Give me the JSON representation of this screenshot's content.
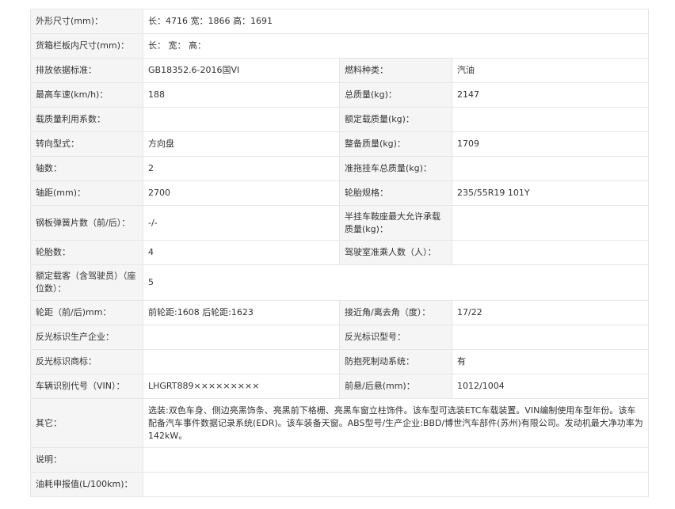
{
  "rows": [
    {
      "cells": [
        {
          "label": "外形尺寸(mm)："
        },
        {
          "value": "长：4716 宽：1866 高：1691",
          "span": 3
        }
      ]
    },
    {
      "cells": [
        {
          "label": "货箱栏板内尺寸(mm)："
        },
        {
          "value": "长： 宽： 高：",
          "span": 3
        }
      ]
    },
    {
      "cells": [
        {
          "label": "排放依据标准："
        },
        {
          "value": "GB18352.6-2016国VI"
        },
        {
          "label": "燃料种类："
        },
        {
          "value": "汽油"
        }
      ]
    },
    {
      "cells": [
        {
          "label": "最高车速(km/h)："
        },
        {
          "value": "188"
        },
        {
          "label": "总质量(kg)："
        },
        {
          "value": "2147"
        }
      ]
    },
    {
      "cells": [
        {
          "label": "载质量利用系数："
        },
        {
          "value": ""
        },
        {
          "label": "额定载质量(kg)："
        },
        {
          "value": ""
        }
      ]
    },
    {
      "cells": [
        {
          "label": "转向型式："
        },
        {
          "value": "方向盘"
        },
        {
          "label": "整备质量(kg)："
        },
        {
          "value": "1709"
        }
      ]
    },
    {
      "cells": [
        {
          "label": "轴数："
        },
        {
          "value": "2"
        },
        {
          "label": "准拖挂车总质量(kg)："
        },
        {
          "value": ""
        }
      ]
    },
    {
      "cells": [
        {
          "label": "轴距(mm)："
        },
        {
          "value": "2700"
        },
        {
          "label": "轮胎规格："
        },
        {
          "value": "235/55R19 101Y"
        }
      ]
    },
    {
      "cells": [
        {
          "label": "钢板弹簧片数（前/后）："
        },
        {
          "value": "-/-"
        },
        {
          "label": "半挂车鞍座最大允许承载质量(kg)："
        },
        {
          "value": ""
        }
      ]
    },
    {
      "cells": [
        {
          "label": "轮胎数："
        },
        {
          "value": "4"
        },
        {
          "label": "驾驶室准乘人数（人）："
        },
        {
          "value": ""
        }
      ]
    },
    {
      "cells": [
        {
          "label": "额定载客（含驾驶员）（座位数）："
        },
        {
          "value": "5",
          "span": 3
        }
      ]
    },
    {
      "cells": [
        {
          "label": "轮距（前/后)mm："
        },
        {
          "value": "前轮距:1608 后轮距:1623"
        },
        {
          "label": "接近角/离去角（度）："
        },
        {
          "value": "17/22"
        }
      ]
    },
    {
      "cells": [
        {
          "label": "反光标识生产企业："
        },
        {
          "value": ""
        },
        {
          "label": "反光标识型号："
        },
        {
          "value": ""
        }
      ]
    },
    {
      "cells": [
        {
          "label": "反光标识商标："
        },
        {
          "value": ""
        },
        {
          "label": "防抱死制动系统："
        },
        {
          "value": "有"
        }
      ]
    },
    {
      "cells": [
        {
          "label": "车辆识别代号（VIN）："
        },
        {
          "value": "LHGRT889×××××××××"
        },
        {
          "label": "前悬/后悬(mm)："
        },
        {
          "value": "1012/1004"
        }
      ]
    },
    {
      "cells": [
        {
          "label": "其它："
        },
        {
          "value": "选装:双色车身、侧边亮黑饰条、亮黑前下格栅、亮黑车窗立柱饰件。该车型可选装ETC车载装置。VIN编制使用车型年份。该车配备汽车事件数据记录系统(EDR)。该车装备天窗。ABS型号/生产企业:BBD/博世汽车部件(苏州)有限公司。发动机最大净功率为142kW。",
          "span": 3
        }
      ]
    },
    {
      "cells": [
        {
          "label": "说明："
        },
        {
          "value": "",
          "span": 3
        }
      ]
    },
    {
      "cells": [
        {
          "label": "油耗申报值(L/100km)："
        },
        {
          "value": "",
          "span": 3
        }
      ]
    }
  ]
}
